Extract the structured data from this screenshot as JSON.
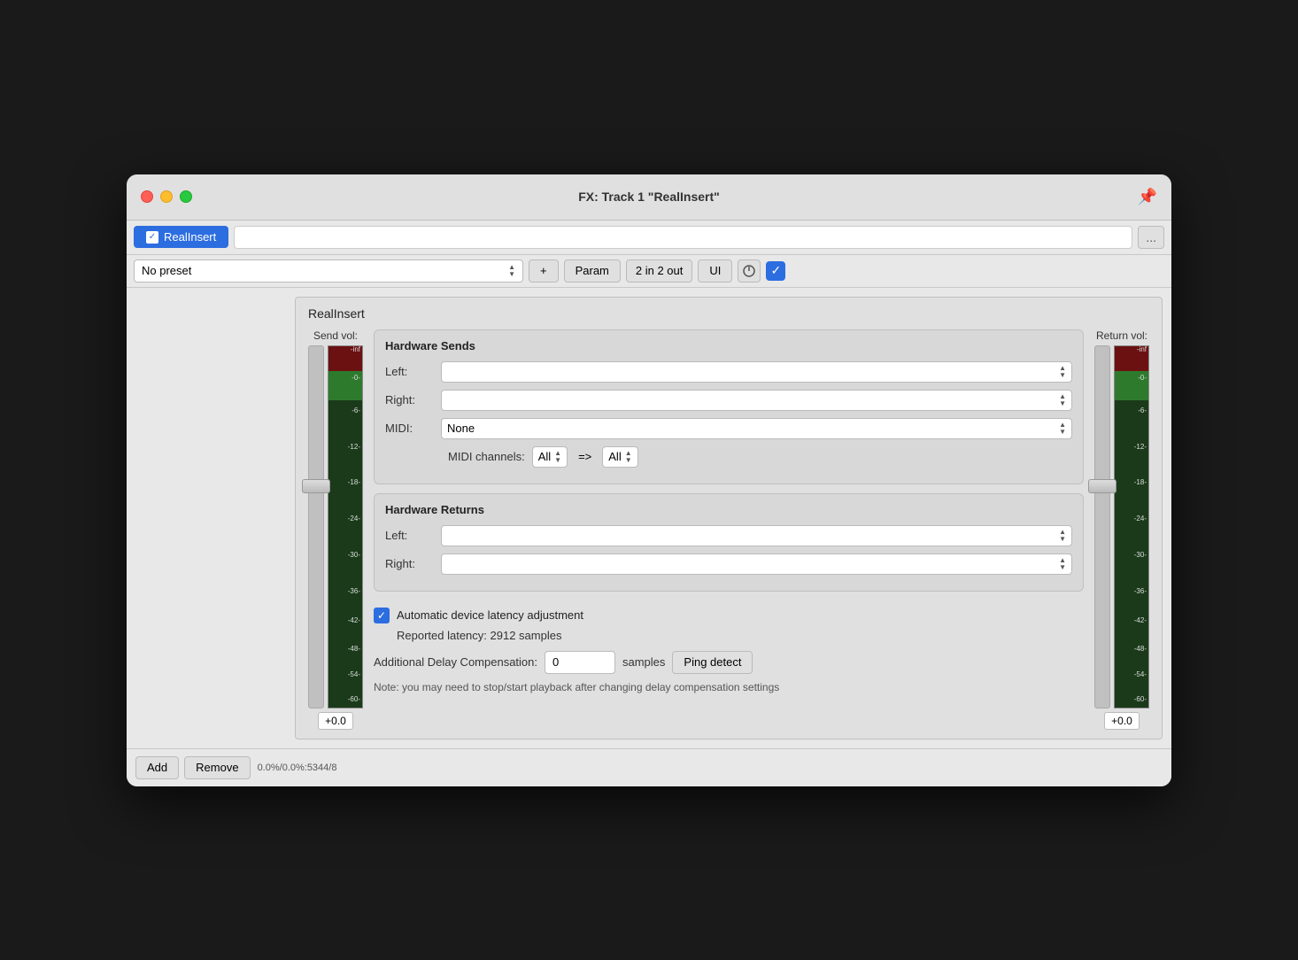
{
  "window": {
    "title": "FX: Track 1 \"RealInsert\""
  },
  "plugin": {
    "name": "RealInsert",
    "enabled": true
  },
  "toolbar": {
    "search_placeholder": "",
    "more_label": "...",
    "preset_label": "No preset",
    "plus_label": "+",
    "param_label": "Param",
    "io_label": "2 in 2 out",
    "ui_label": "UI"
  },
  "send_vol": {
    "label": "Send vol:",
    "value": "+0.0"
  },
  "return_vol": {
    "label": "Return vol:",
    "value": "+0.0"
  },
  "meter_ticks": [
    "-inf",
    "-0-",
    "-6-",
    "-12-",
    "-18-",
    "-24-",
    "-30-",
    "-36-",
    "-42-",
    "-48-",
    "-54-",
    "-60-"
  ],
  "hardware_sends": {
    "title": "Hardware Sends",
    "left_label": "Left:",
    "right_label": "Right:",
    "midi_label": "MIDI:",
    "midi_value": "None",
    "midi_channels_label": "MIDI channels:",
    "all1": "All",
    "arrow": "=>",
    "all2": "All"
  },
  "hardware_returns": {
    "title": "Hardware Returns",
    "left_label": "Left:",
    "right_label": "Right:"
  },
  "latency": {
    "auto_label": "Automatic device latency adjustment",
    "reported_label": "Reported latency: 2912 samples",
    "delay_label": "Additional Delay Compensation:",
    "delay_value": "0",
    "samples_label": "samples",
    "ping_label": "Ping detect"
  },
  "note": {
    "text": "Note: you may need to stop/start playback after changing delay compensation settings"
  },
  "bottom": {
    "add_label": "Add",
    "remove_label": "Remove",
    "status": "0.0%/0.0%:5344/8"
  }
}
